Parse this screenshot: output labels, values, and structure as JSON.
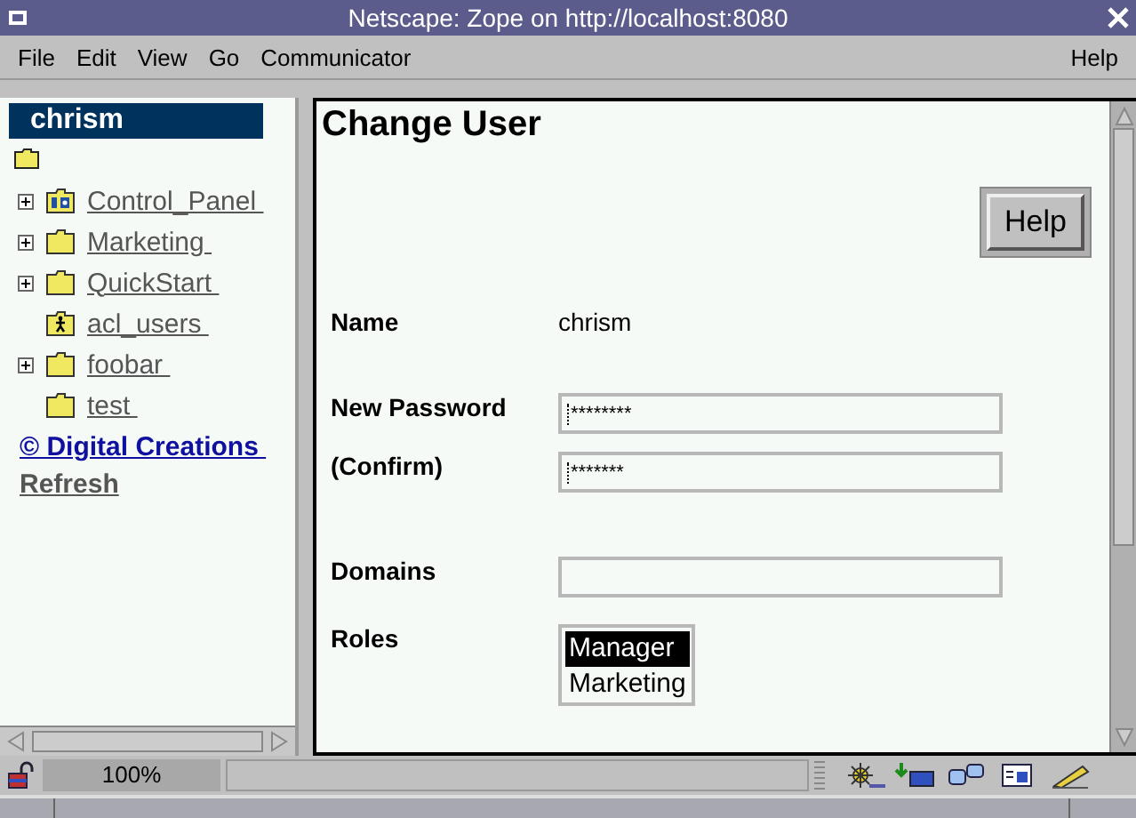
{
  "window": {
    "title": "Netscape: Zope on http://localhost:8080"
  },
  "menu": [
    "File",
    "Edit",
    "View",
    "Go",
    "Communicator"
  ],
  "help_menu": "Help",
  "sidebar": {
    "user": "chrism",
    "items": [
      {
        "label": "Control_Panel",
        "kind": "control-panel",
        "expandable": true
      },
      {
        "label": "Marketing",
        "kind": "folder",
        "expandable": true
      },
      {
        "label": "QuickStart",
        "kind": "folder",
        "expandable": true
      },
      {
        "label": "acl_users",
        "kind": "user-folder",
        "expandable": false
      },
      {
        "label": "foobar",
        "kind": "folder",
        "expandable": true
      },
      {
        "label": "test",
        "kind": "folder",
        "expandable": false
      }
    ],
    "copyright_link": "© Digital Creations",
    "refresh_link": "Refresh"
  },
  "page": {
    "title": "Change User",
    "help_button": "Help",
    "name_label": "Name",
    "name_value": "chrism",
    "fields": [
      {
        "label": "New Password",
        "value": "********"
      },
      {
        "label": "(Confirm)",
        "value": "*******"
      }
    ],
    "domains_label": "Domains",
    "roles_label": "Roles",
    "roles": [
      {
        "label": "Manager",
        "selected": true
      },
      {
        "label": "Marketing",
        "selected": false
      }
    ]
  },
  "status_bar": {
    "zoom": "100%"
  }
}
